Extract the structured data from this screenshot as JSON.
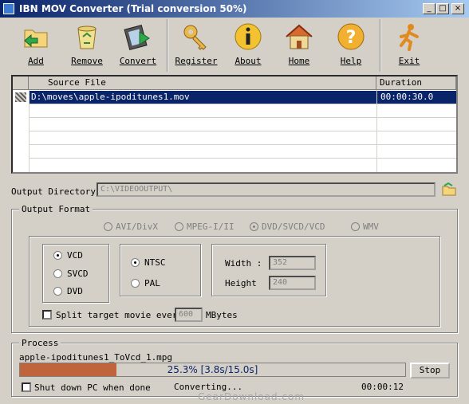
{
  "window": {
    "title": "IBN MOV Converter (Trial conversion 50%)",
    "min": "_",
    "max": "□",
    "close": "×"
  },
  "toolbar": {
    "add": "Add",
    "remove": "Remove",
    "convert": "Convert",
    "register": "Register",
    "about": "About",
    "home": "Home",
    "help": "Help",
    "exit": "Exit"
  },
  "file_list": {
    "headers": {
      "source": "Source File",
      "duration": "Duration"
    },
    "rows": [
      {
        "source": "D:\\moves\\apple-ipoditunes1.mov",
        "duration": "00:00:30.0"
      }
    ]
  },
  "output": {
    "label": "Output Directory:",
    "value": "C:\\VIDEOOUTPUT\\"
  },
  "format": {
    "legend": "Output Format",
    "types": [
      "AVI/DivX",
      "MPEG-I/II",
      "DVD/SVCD/VCD",
      "WMV"
    ],
    "selected_type": "DVD/SVCD/VCD",
    "discs": [
      "VCD",
      "SVCD",
      "DVD"
    ],
    "selected_disc": "VCD",
    "systems": [
      "NTSC",
      "PAL"
    ],
    "selected_system": "NTSC",
    "width_label": "Width :",
    "width": "352",
    "height_label": "Height",
    "height": "240",
    "split_label": "Split target movie every",
    "split_value": "600",
    "split_unit": "MBytes"
  },
  "process": {
    "legend": "Process",
    "file": "apple-ipoditunes1_ToVcd_1.mpg",
    "progress": 0.25,
    "progress_text": "25.3% [3.8s/15.0s]",
    "stop": "Stop",
    "shutdown": "Shut down PC when done",
    "status": "Converting...",
    "elapsed": "00:00:12"
  },
  "watermark": "GearDownload.com",
  "colors": {
    "selection": "#0a246a",
    "progress": "#c0643c",
    "titlebar": "#0a246a"
  }
}
